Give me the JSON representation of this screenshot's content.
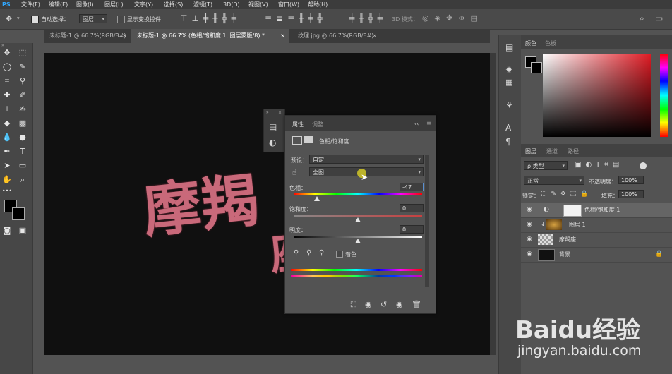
{
  "menubar": {
    "logo": "PS",
    "items": [
      "文件(F)",
      "编辑(E)",
      "图像(I)",
      "图层(L)",
      "文字(Y)",
      "选择(S)",
      "滤镜(T)",
      "3D(D)",
      "视图(V)",
      "窗口(W)",
      "帮助(H)"
    ]
  },
  "options": {
    "auto_select_label": "自动选择：",
    "auto_select_value": "图层",
    "show_transform_label": "显示变换控件",
    "mode_3d_label": "3D 模式："
  },
  "tabs": [
    {
      "label": "未标题-1 @ 66.7%(RGB/8#)"
    },
    {
      "label": "未标题-1 @ 66.7% (色相/饱和度 1, 图层蒙版/8) *"
    },
    {
      "label": "纹理.jpg @ 66.7%(RGB/8#)"
    }
  ],
  "canvas_text": {
    "line1": "摩羯",
    "partial": "座"
  },
  "properties": {
    "tab1": "属性",
    "tab2": "调整",
    "title": "色相/饱和度",
    "preset_label": "预设：",
    "preset_value": "自定",
    "channel_value": "全图",
    "hue_label": "色相：",
    "hue_value": "-47",
    "hue_pos": 0.18,
    "saturation_label": "饱和度：",
    "saturation_value": "0",
    "saturation_pos": 0.5,
    "lightness_label": "明度：",
    "lightness_value": "0",
    "lightness_pos": 0.5,
    "colorize_label": "着色"
  },
  "color_panel": {
    "tab1": "颜色",
    "tab2": "色板"
  },
  "layers_panel": {
    "tab1": "图层",
    "tab2": "通道",
    "tab3": "路径",
    "filter_label": "ρ 类型",
    "blend_mode": "正常",
    "opacity_label": "不透明度：",
    "opacity_value": "100%",
    "lock_label": "锁定：",
    "fill_label": "填充：",
    "fill_value": "100%",
    "layers": [
      {
        "name": "色相/饱和度 1",
        "selected": true
      },
      {
        "name": "图层 1",
        "selected": false
      },
      {
        "name": "摩羯座",
        "selected": false
      },
      {
        "name": "背景",
        "selected": false
      }
    ]
  },
  "watermark": {
    "brand": "Baidu经验",
    "url": "jingyan.baidu.com"
  },
  "colors": {
    "accent": "#c9697a",
    "panel": "#535353",
    "canvas": "#101010"
  }
}
